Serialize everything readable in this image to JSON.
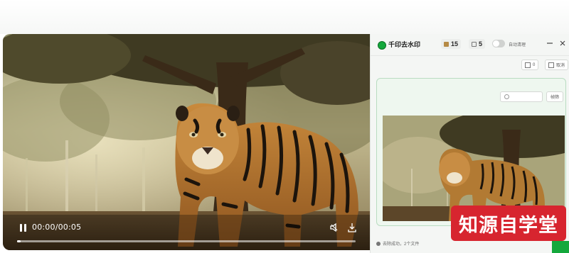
{
  "video": {
    "time": "00:00/00:05",
    "progress": 0.01
  },
  "app": {
    "title": "千印去水印",
    "count_a": "15",
    "count_b": "5",
    "toggle_label": "自动清理",
    "tool_btn_1": "0",
    "tool_btn_2": "取消",
    "search_placeholder": "",
    "search_button": "帧筛",
    "status": "去除成功，2个文件"
  },
  "watermark": "知源自学堂",
  "colors": {
    "accent": "#14a83c",
    "watermark_bg": "#d7252f",
    "panel_border": "#b9dcc1"
  },
  "icons": {
    "play": "pause-icon",
    "volume": "volume-icon",
    "download": "download-icon"
  }
}
